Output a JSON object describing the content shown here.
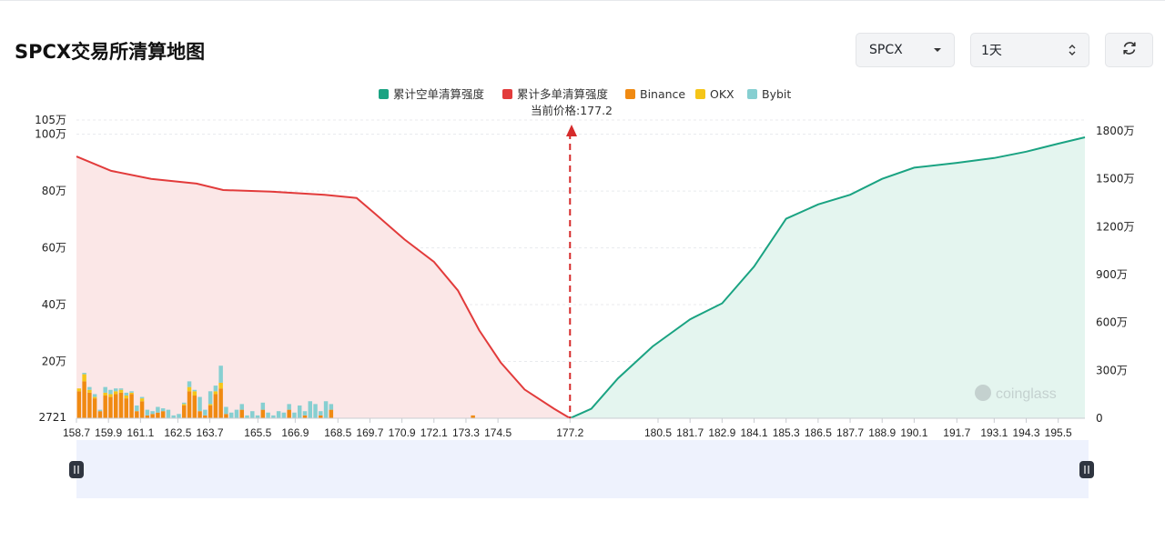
{
  "header": {
    "title": "SPCX交易所清算地图",
    "symbol_value": "SPCX",
    "interval_value": "1天"
  },
  "colors": {
    "short_cum": "#1aa382",
    "long_cum": "#e23b3b",
    "binance": "#f08a12",
    "okx": "#f5c518",
    "bybit": "#86cfd1",
    "long_fill": "#fbe7e7",
    "short_fill": "#e4f5ef"
  },
  "icons": {
    "dropdown": "caret-down-icon",
    "stepper": "up-down-chevron-icon",
    "refresh": "refresh-icon",
    "range_handle": "pause-grip-icon"
  },
  "chart_data": {
    "type": "bar",
    "legend": [
      "累计空单清算强度",
      "累计多单清算强度",
      "Binance",
      "OKX",
      "Bybit"
    ],
    "current_price_label": "当前价格:177.2",
    "current_price": 177.2,
    "watermark": "coinglass",
    "y_left_ticks": [
      "2721",
      "20万",
      "40万",
      "60万",
      "80万",
      "100万",
      "105万"
    ],
    "y_left_values": [
      2721,
      200000,
      400000,
      600000,
      800000,
      1000000,
      1050000
    ],
    "y_right_ticks": [
      "0",
      "300万",
      "600万",
      "900万",
      "1200万",
      "1500万",
      "1800万"
    ],
    "y_right_values": [
      0,
      3000000,
      6000000,
      9000000,
      12000000,
      15000000,
      18000000
    ],
    "x_ticks": [
      "158.7",
      "159.9",
      "161.1",
      "162.5",
      "163.7",
      "165.5",
      "166.9",
      "168.5",
      "169.7",
      "170.9",
      "172.1",
      "173.3",
      "174.5",
      "177.2",
      "180.5",
      "181.7",
      "182.9",
      "184.1",
      "185.3",
      "186.5",
      "187.7",
      "188.9",
      "190.1",
      "191.7",
      "193.1",
      "194.3",
      "195.5"
    ],
    "bar_count": 192,
    "bars": {
      "binance": [
        95000,
        130000,
        90000,
        70000,
        25000,
        80000,
        75000,
        85000,
        90000,
        70000,
        85000,
        25000,
        60000,
        10000,
        15000,
        20000,
        25000,
        0,
        0,
        0,
        45000,
        95000,
        80000,
        25000,
        10000,
        45000,
        85000,
        105000,
        15000,
        0,
        0,
        30000,
        0,
        0,
        0,
        30000,
        0,
        0,
        0,
        0,
        30000,
        0,
        0,
        10000,
        0,
        0,
        10000,
        0,
        30000,
        0,
        0,
        0,
        0,
        0,
        0,
        0,
        0,
        0,
        0,
        0,
        0,
        0,
        0,
        0,
        0,
        0,
        0,
        0,
        0,
        0,
        0,
        0,
        0,
        0,
        0,
        10000,
        0,
        0,
        0,
        0,
        0,
        0,
        0,
        0,
        0,
        0,
        0,
        0,
        0,
        0,
        0,
        0,
        0,
        0,
        0,
        0,
        0,
        0,
        0,
        0,
        0,
        0,
        0,
        0,
        0,
        0,
        0,
        0,
        0,
        0,
        0,
        0,
        0,
        0,
        0,
        0,
        0,
        0,
        0,
        0,
        0,
        0,
        0,
        0,
        0,
        0,
        0,
        0,
        0,
        0,
        0,
        0,
        0,
        0,
        0,
        0,
        0,
        0,
        0,
        0,
        0,
        0,
        0,
        0,
        0,
        0,
        0,
        0,
        0,
        0,
        0,
        0,
        0,
        0,
        0,
        0,
        0,
        0,
        0,
        0,
        0,
        0,
        0,
        0,
        0,
        0,
        0,
        0,
        0,
        0,
        0,
        0,
        0,
        0,
        0,
        0,
        0,
        0,
        0,
        0,
        0,
        0,
        0,
        0,
        0,
        0,
        0,
        0,
        0,
        0,
        0,
        0,
        0,
        0,
        0,
        0,
        0,
        0,
        0,
        0
      ],
      "okx": [
        10000,
        25000,
        10000,
        5000,
        0,
        10000,
        10000,
        10000,
        10000,
        10000,
        5000,
        0,
        10000,
        0,
        0,
        0,
        0,
        0,
        0,
        0,
        5000,
        15000,
        15000,
        0,
        0,
        5000,
        10000,
        20000,
        0,
        0,
        0,
        0,
        0,
        0,
        0,
        0,
        0,
        0,
        0,
        0,
        0,
        0,
        0,
        0,
        0,
        0,
        0,
        0,
        0,
        0,
        0,
        0,
        0,
        0,
        0,
        0,
        0,
        0,
        0,
        0,
        0,
        0,
        0,
        0,
        0,
        0,
        0,
        0,
        0,
        0,
        0,
        0,
        0,
        0,
        0,
        0,
        0,
        0,
        0,
        0,
        0,
        0,
        0,
        0,
        0,
        0,
        0,
        0,
        0,
        0,
        0,
        0,
        0,
        0,
        0,
        0,
        0,
        0,
        0,
        0,
        0,
        0,
        0,
        0,
        0,
        0,
        0,
        0,
        0,
        0,
        0,
        0,
        0,
        0,
        0,
        0,
        0,
        0,
        0,
        0,
        0,
        0,
        0,
        0,
        0,
        0,
        0,
        0,
        0,
        0,
        0,
        0,
        0,
        0,
        0,
        0,
        0,
        0,
        0,
        0,
        0,
        0,
        0,
        0,
        0,
        0,
        0,
        0,
        0,
        0,
        0,
        0,
        0,
        0,
        0,
        0,
        0,
        0,
        0,
        0,
        0,
        0,
        0,
        0,
        0,
        0,
        0,
        0,
        0,
        0,
        0,
        0,
        0,
        0,
        0,
        0,
        0,
        0,
        0,
        0,
        0,
        0,
        0,
        0,
        0,
        0,
        0,
        0,
        0,
        0,
        0,
        0,
        0,
        0,
        0,
        0
      ],
      "bybit": [
        0,
        5000,
        10000,
        10000,
        5000,
        20000,
        15000,
        10000,
        5000,
        10000,
        5000,
        20000,
        5000,
        20000,
        10000,
        20000,
        10000,
        30000,
        10000,
        15000,
        5000,
        20000,
        5000,
        50000,
        20000,
        45000,
        20000,
        60000,
        25000,
        20000,
        30000,
        20000,
        10000,
        25000,
        10000,
        25000,
        20000,
        10000,
        25000,
        20000,
        20000,
        20000,
        45000,
        15000,
        60000,
        50000,
        15000,
        60000,
        20000,
        0,
        0,
        0,
        0,
        0,
        0,
        0,
        0,
        0,
        0,
        0,
        0,
        0,
        0,
        0,
        0,
        0,
        0,
        0,
        0,
        0,
        0,
        0,
        0,
        0,
        0,
        0,
        0,
        0,
        0,
        0,
        0,
        0,
        0,
        0,
        0,
        0,
        0,
        0,
        0,
        0,
        0,
        0,
        0,
        0,
        0,
        0,
        0,
        0,
        0,
        0,
        0,
        0,
        0,
        0,
        0,
        0,
        0,
        0,
        0,
        0,
        0,
        0,
        0,
        0,
        0,
        0,
        0,
        0,
        0,
        0,
        0,
        0,
        0,
        0,
        0,
        0,
        0,
        0,
        0,
        0,
        0,
        0,
        0,
        0,
        0,
        0,
        0,
        0,
        0,
        0,
        0,
        0,
        0,
        0,
        0,
        0,
        0,
        0,
        0,
        0,
        0,
        0,
        0,
        0,
        0,
        0,
        0,
        0,
        0,
        0,
        0,
        0,
        0,
        0,
        0,
        0,
        0,
        0,
        0,
        0,
        0,
        0,
        0,
        0,
        0,
        0,
        0,
        0,
        0,
        0,
        0,
        0,
        0,
        0,
        0,
        0,
        0,
        0,
        0,
        0,
        0,
        0,
        0,
        0,
        0,
        0,
        0,
        0,
        0,
        0,
        0,
        0,
        0,
        0,
        0,
        0,
        0
      ]
    },
    "long_cum_points": [
      [
        158.7,
        16400000
      ],
      [
        160.0,
        15500000
      ],
      [
        161.5,
        15000000
      ],
      [
        163.2,
        14700000
      ],
      [
        164.2,
        14300000
      ],
      [
        166.0,
        14200000
      ],
      [
        168.0,
        14000000
      ],
      [
        169.2,
        13800000
      ],
      [
        169.9,
        12800000
      ],
      [
        171.0,
        11200000
      ],
      [
        172.1,
        9800000
      ],
      [
        173.0,
        8000000
      ],
      [
        173.8,
        5500000
      ],
      [
        174.6,
        3500000
      ],
      [
        175.5,
        1800000
      ],
      [
        176.6,
        600000
      ],
      [
        177.2,
        0
      ]
    ],
    "short_cum_points": [
      [
        177.2,
        0
      ],
      [
        178.0,
        600000
      ],
      [
        179.0,
        2500000
      ],
      [
        180.3,
        4500000
      ],
      [
        181.7,
        6200000
      ],
      [
        182.9,
        7200000
      ],
      [
        184.1,
        9500000
      ],
      [
        185.3,
        12500000
      ],
      [
        186.5,
        13400000
      ],
      [
        187.7,
        14000000
      ],
      [
        188.9,
        15000000
      ],
      [
        190.1,
        15700000
      ],
      [
        191.7,
        16000000
      ],
      [
        193.1,
        16300000
      ],
      [
        194.3,
        16700000
      ],
      [
        195.5,
        17200000
      ],
      [
        196.5,
        17600000
      ]
    ],
    "x_min": 158.7,
    "x_max": 196.5,
    "grid": true,
    "legend_position": "top-center"
  }
}
